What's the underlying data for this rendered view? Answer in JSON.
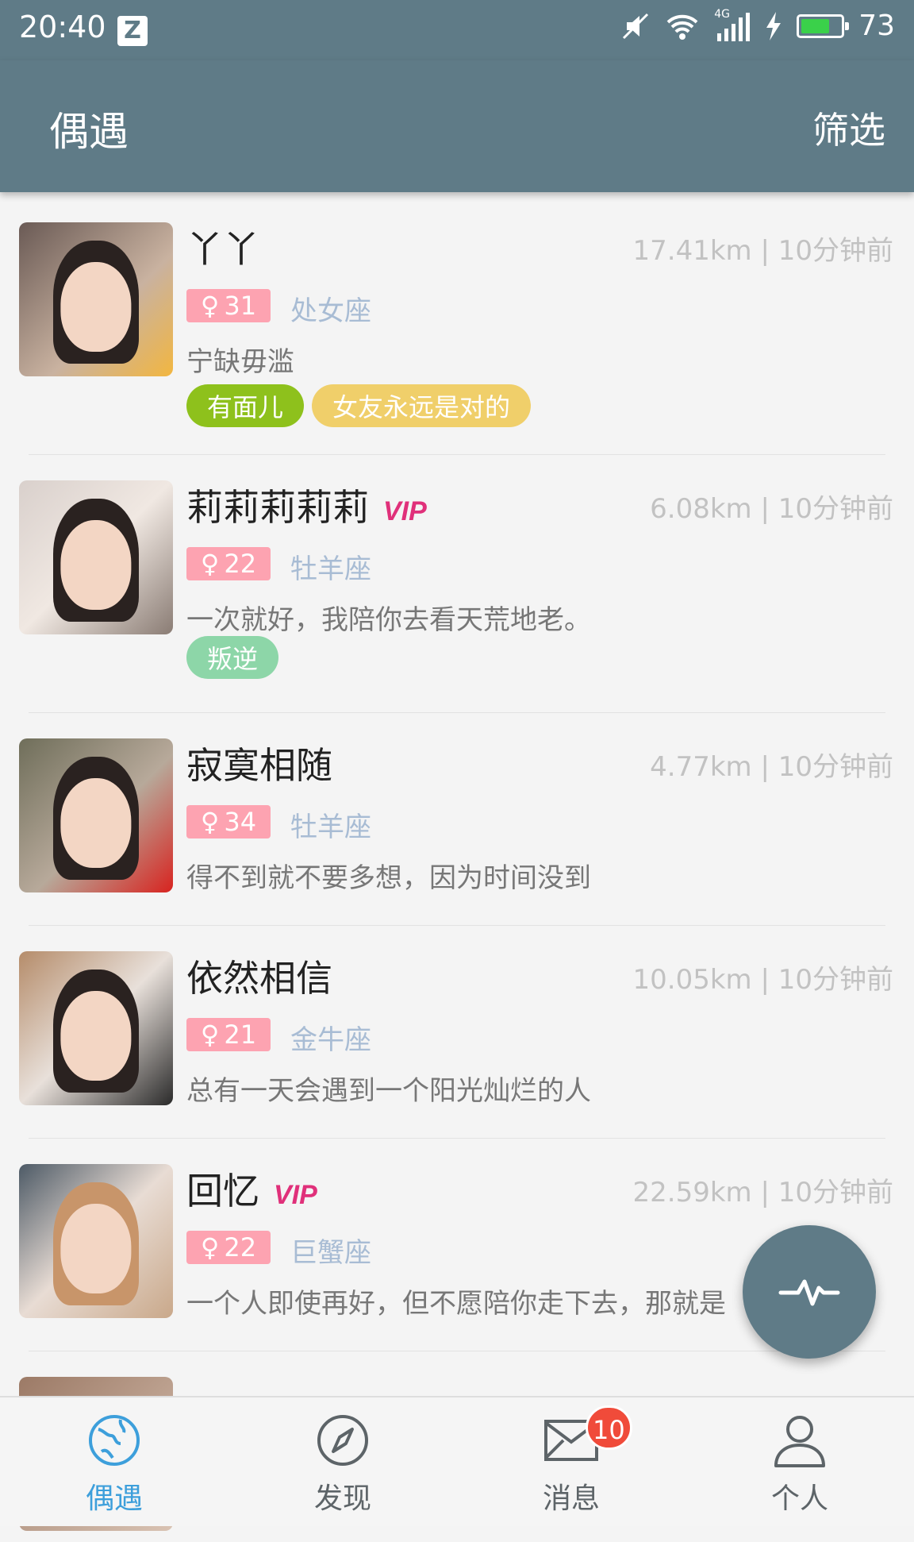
{
  "status_bar": {
    "time": "20:40",
    "notification_icon": "z-app-icon",
    "network": "4G",
    "battery": "73",
    "battery_level": 0.73
  },
  "appbar": {
    "title": "偶遇",
    "filter": "筛选"
  },
  "users": [
    {
      "name": "丫丫",
      "vip": "",
      "meta": "17.41km | 10分钟前",
      "age": "31",
      "zodiac": "处女座",
      "motto": "宁缺毋滥",
      "tags": [
        {
          "label": "有面儿",
          "color": "#8ec11c"
        },
        {
          "label": "女友永远是对的",
          "color": "#f0cf6a"
        }
      ]
    },
    {
      "name": "莉莉莉莉莉",
      "vip": "VIP",
      "meta": "6.08km | 10分钟前",
      "age": "22",
      "zodiac": "牡羊座",
      "motto": "一次就好，我陪你去看天荒地老。",
      "tags": [
        {
          "label": "叛逆",
          "color": "#8dd6a8"
        }
      ]
    },
    {
      "name": "寂寞相随",
      "vip": "",
      "meta": "4.77km | 10分钟前",
      "age": "34",
      "zodiac": "牡羊座",
      "motto": "得不到就不要多想，因为时间没到",
      "tags": []
    },
    {
      "name": "依然相信",
      "vip": "",
      "meta": "10.05km | 10分钟前",
      "age": "21",
      "zodiac": "金牛座",
      "motto": "总有一天会遇到一个阳光灿烂的人",
      "tags": []
    },
    {
      "name": "回忆",
      "vip": "VIP",
      "meta": "22.59km | 10分钟前",
      "age": "22",
      "zodiac": "巨蟹座",
      "motto": "一个人即使再好，但不愿陪你走下去，那就是",
      "tags": []
    }
  ],
  "colors": {
    "primary": "#5f7b87",
    "age_badge": "#fda3b1",
    "vip": "#e0307a",
    "nav_active": "#3d9fdb",
    "badge": "#f04b3a"
  },
  "fab": {
    "icon": "pulse-icon"
  },
  "bottom_nav": [
    {
      "label": "偶遇",
      "icon": "globe-icon",
      "active": true
    },
    {
      "label": "发现",
      "icon": "compass-icon",
      "active": false
    },
    {
      "label": "消息",
      "icon": "envelope-icon",
      "active": false,
      "badge": "10"
    },
    {
      "label": "个人",
      "icon": "person-icon",
      "active": false
    }
  ]
}
